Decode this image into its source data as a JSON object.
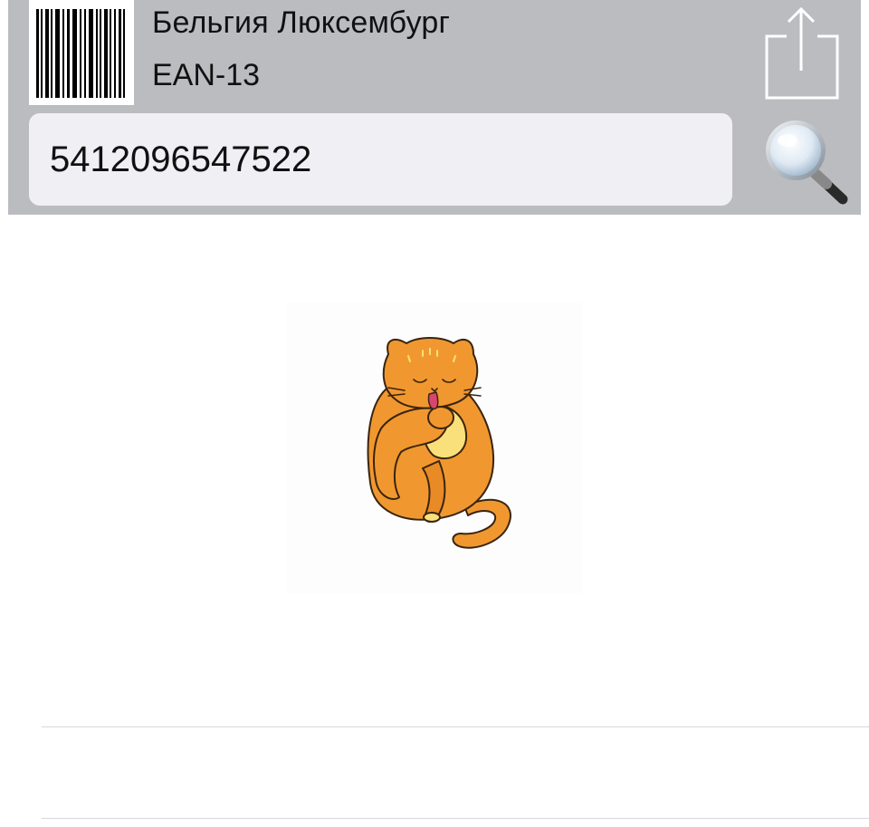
{
  "header": {
    "country": "Бельгия Люксембург",
    "format": "EAN-13",
    "share_icon": "share-icon",
    "barcode_icon": "barcode-icon"
  },
  "search": {
    "value": "5412096547522",
    "icon": "magnifier-icon"
  },
  "product": {
    "image": "orange-cat-licking-paw-illustration"
  },
  "colors": {
    "header_bg": "#bbbcc0",
    "field_bg": "#efeff4",
    "cat_orange": "#f0982f",
    "cat_belly": "#f9e07a"
  }
}
